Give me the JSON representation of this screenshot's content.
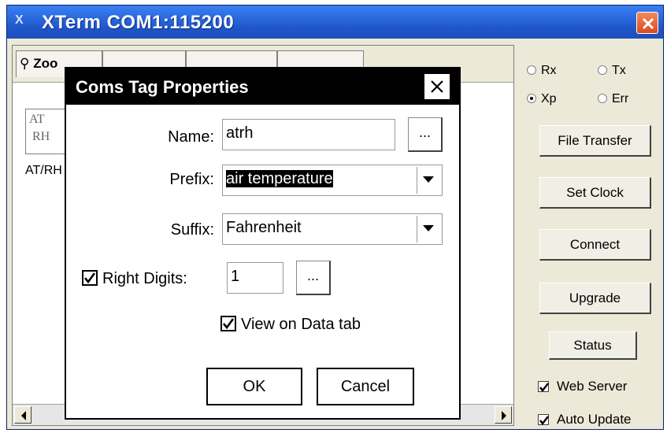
{
  "window": {
    "title": "XTerm COM1:115200",
    "icon": "xterm-app-icon",
    "tabs": [
      "Zoo",
      "",
      "",
      ""
    ],
    "list_item": {
      "icon_line1": "AT",
      "icon_line2": "RH",
      "label": "AT/RH"
    }
  },
  "right_panel": {
    "radios": [
      {
        "label": "Rx",
        "checked": false
      },
      {
        "label": "Tx",
        "checked": false
      },
      {
        "label": "Xp",
        "checked": true
      },
      {
        "label": "Err",
        "checked": false
      }
    ],
    "buttons": {
      "file_transfer": "File Transfer",
      "set_clock": "Set Clock",
      "connect": "Connect",
      "upgrade": "Upgrade",
      "status": "Status"
    },
    "checkboxes": {
      "web_server": {
        "label": "Web Server",
        "checked": true
      },
      "auto_update": {
        "label": "Auto Update",
        "checked": true
      }
    }
  },
  "dialog": {
    "title": "Coms Tag Properties",
    "name_label": "Name:",
    "name_value": "atrh",
    "name_browse": "...",
    "prefix_label": "Prefix:",
    "prefix_value": "air temperature",
    "suffix_label": "Suffix:",
    "suffix_value": "Fahrenheit",
    "right_digits_label": "Right Digits:",
    "right_digits_checked": true,
    "right_digits_value": "1",
    "right_digits_browse": "...",
    "view_on_data_label": "View on Data tab",
    "view_on_data_checked": true,
    "ok_label": "OK",
    "cancel_label": "Cancel"
  },
  "colors": {
    "titlebar": "#2a68dc",
    "window_bg": "#ece9d8",
    "close_red": "#d94a1e",
    "dialog_title_bg": "#000000"
  }
}
